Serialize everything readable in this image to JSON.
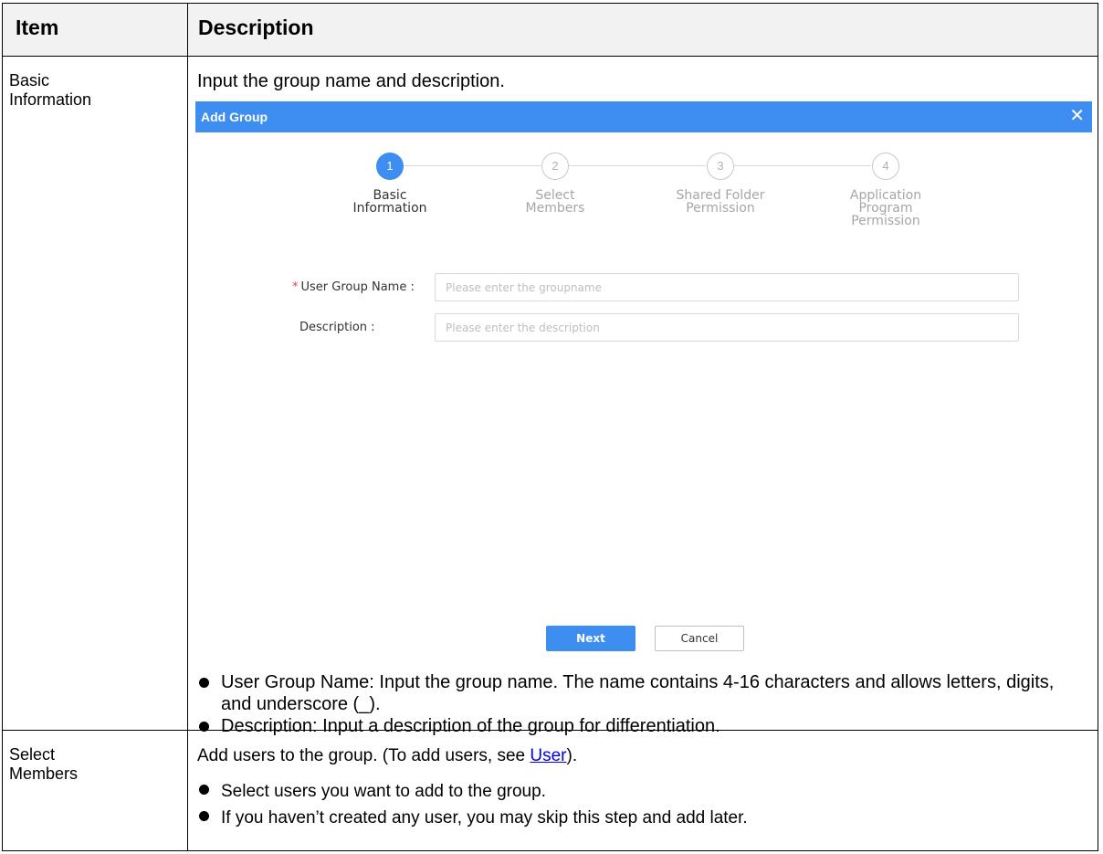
{
  "table": {
    "headers": {
      "item": "Item",
      "description": "Description"
    },
    "rows": [
      {
        "item": "Basic\nInformation",
        "intro": "Input the group name and description.",
        "bullets": [
          "User Group Name: Input the group name. The name contains 4-16 characters and allows letters, digits, and underscore (_).",
          "Description: Input a description of the group for differentiation."
        ]
      },
      {
        "item": "Select\nMembers",
        "intro_before_link": "Add users to the group. (To add users, see ",
        "intro_link": "User",
        "intro_after_link": ").",
        "bullets": [
          "Select users you want to add to the group.",
          "If you haven’t created any user, you may skip this step and add later."
        ]
      }
    ]
  },
  "dialog": {
    "title": "Add Group",
    "close_icon": "close-icon",
    "steps": [
      {
        "number": "1",
        "label": "Basic\nInformation",
        "active": true
      },
      {
        "number": "2",
        "label": "Select\nMembers",
        "active": false
      },
      {
        "number": "3",
        "label": "Shared Folder\nPermission",
        "active": false
      },
      {
        "number": "4",
        "label": "Application\nProgram\nPermission",
        "active": false
      }
    ],
    "form": {
      "group_name": {
        "required_mark": "*",
        "label": "User Group Name :",
        "placeholder": "Please enter the groupname",
        "value": ""
      },
      "description": {
        "label": "Description :",
        "placeholder": "Please enter the description",
        "value": ""
      }
    },
    "buttons": {
      "next": "Next",
      "cancel": "Cancel"
    }
  },
  "colors": {
    "accent": "#3d8ef0",
    "required": "#e54545",
    "header_bg": "#f2f2f2"
  }
}
